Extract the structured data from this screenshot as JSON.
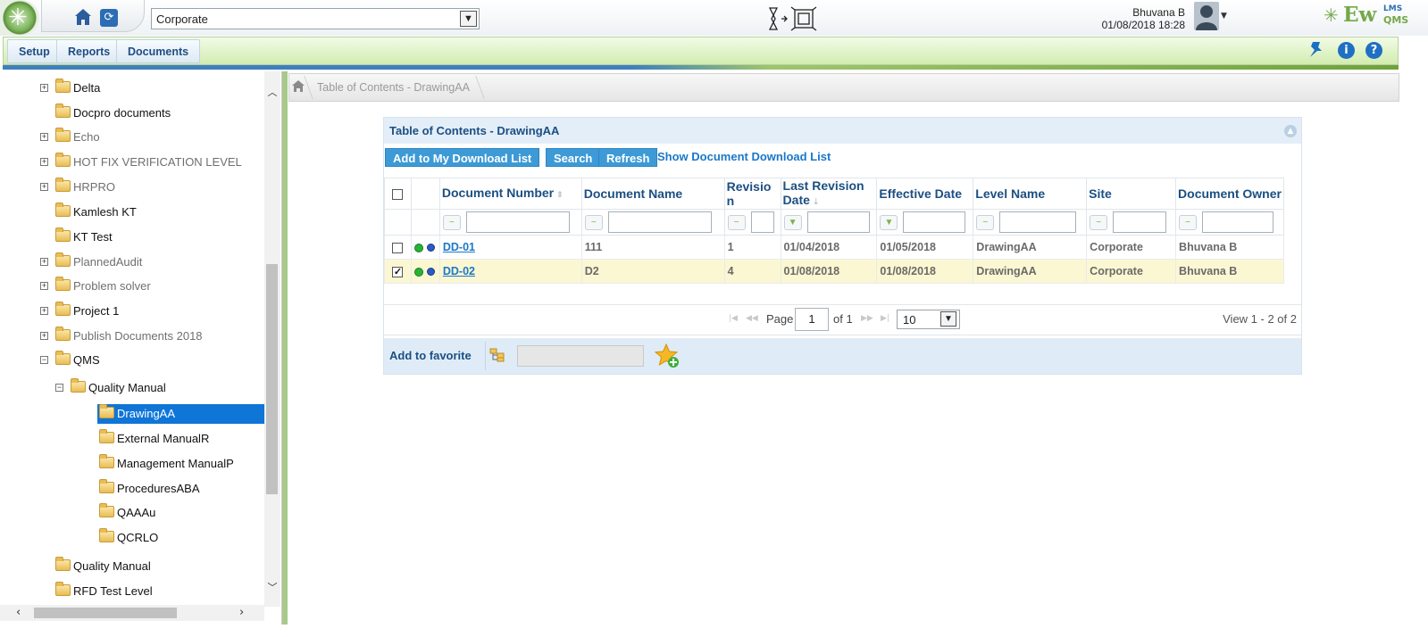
{
  "header": {
    "site_value": "Corporate",
    "user_name": "Bhuvana B",
    "user_datetime": "01/08/2018 18:28",
    "brand": {
      "main": "Ew",
      "top": "LMS",
      "bottom": "QMS"
    },
    "icons": [
      "app-logo-icon",
      "home-icon",
      "refresh-icon",
      "switch-screen-icon",
      "avatar-icon",
      "caret-down-icon"
    ]
  },
  "menu": {
    "items": [
      "Setup",
      "Reports",
      "Documents"
    ],
    "right_icons": [
      "pin-icon",
      "info-icon",
      "help-icon"
    ]
  },
  "tree": {
    "items": [
      {
        "label": "Delta",
        "expander": "+",
        "style": "black"
      },
      {
        "label": "Docpro documents",
        "expander": "",
        "style": "black"
      },
      {
        "label": "Echo",
        "expander": "+",
        "style": "gray"
      },
      {
        "label": "HOT FIX VERIFICATION LEVEL",
        "expander": "+",
        "style": "gray"
      },
      {
        "label": "HRPRO",
        "expander": "+",
        "style": "gray"
      },
      {
        "label": "Kamlesh KT",
        "expander": "",
        "style": "black"
      },
      {
        "label": "KT Test",
        "expander": "",
        "style": "black"
      },
      {
        "label": "PlannedAudit",
        "expander": "+",
        "style": "gray"
      },
      {
        "label": "Problem solver",
        "expander": "+",
        "style": "gray"
      },
      {
        "label": "Project 1",
        "expander": "+",
        "style": "black"
      },
      {
        "label": "Publish Documents 2018",
        "expander": "+",
        "style": "gray"
      },
      {
        "label": "QMS",
        "expander": "−",
        "style": "black"
      },
      {
        "label": "Quality Manual",
        "expander": "−",
        "style": "black"
      },
      {
        "label": "DrawingAA",
        "expander": "",
        "style": "selected"
      },
      {
        "label": "External ManualR",
        "expander": "",
        "style": "black"
      },
      {
        "label": "Management ManualP",
        "expander": "",
        "style": "black"
      },
      {
        "label": "ProceduresABA",
        "expander": "",
        "style": "black"
      },
      {
        "label": "QAAAu",
        "expander": "",
        "style": "black"
      },
      {
        "label": "QCRLO",
        "expander": "",
        "style": "black"
      },
      {
        "label": "Quality Manual",
        "expander": "",
        "style": "black"
      },
      {
        "label": "RFD Test Level",
        "expander": "",
        "style": "black"
      }
    ]
  },
  "breadcrumb": {
    "text": "Table of Contents - DrawingAA"
  },
  "grid": {
    "title": "Table of Contents - DrawingAA",
    "buttons": {
      "add_download": "Add to My Download List",
      "search": "Search",
      "refresh": "Refresh"
    },
    "show_download_link": "Show Document Download List",
    "columns": [
      {
        "key": "number",
        "label": "Document Number"
      },
      {
        "key": "name",
        "label": "Document Name"
      },
      {
        "key": "revision",
        "label": "Revisio n"
      },
      {
        "key": "last_rev",
        "label": "Last Revision Date"
      },
      {
        "key": "effective",
        "label": "Effective Date"
      },
      {
        "key": "level",
        "label": "Level Name"
      },
      {
        "key": "site",
        "label": "Site"
      },
      {
        "key": "owner",
        "label": "Document Owner"
      }
    ],
    "rows": [
      {
        "checked": false,
        "number": "DD-01",
        "name": "111",
        "revision": "1",
        "last_rev": "01/04/2018",
        "effective": "01/05/2018",
        "level": "DrawingAA",
        "site": "Corporate",
        "owner": "Bhuvana B"
      },
      {
        "checked": true,
        "number": "DD-02",
        "name": "D2",
        "revision": "4",
        "last_rev": "01/08/2018",
        "effective": "01/08/2018",
        "level": "DrawingAA",
        "site": "Corporate",
        "owner": "Bhuvana B"
      }
    ],
    "pager": {
      "page_label": "Page",
      "page_value": "1",
      "of_label": "of 1",
      "rows_per_page": "10",
      "view_text": "View 1 - 2 of 2"
    }
  },
  "favorite": {
    "label": "Add to favorite"
  },
  "colors": {
    "accent_blue": "#3d9ad6",
    "link_blue": "#1a78c9",
    "header_text": "#1b4f82",
    "menu_green": "#d2ecb0",
    "tree_selected": "#0f75d7"
  }
}
